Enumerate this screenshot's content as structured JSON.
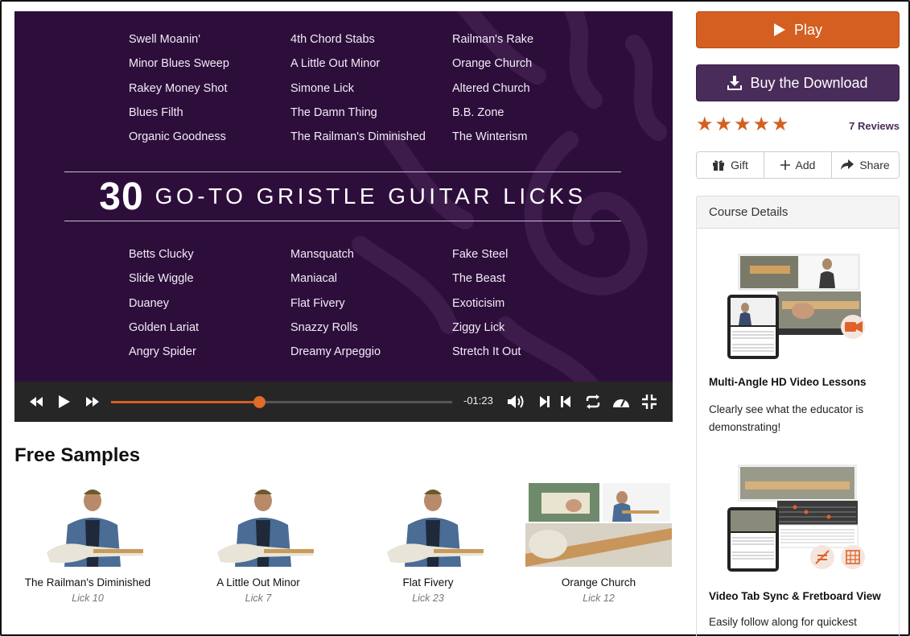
{
  "video": {
    "title_number": "30",
    "title_text": "GO-TO GRISTLE GUITAR LICKS",
    "top_columns": [
      [
        "Swell Moanin'",
        "Minor Blues Sweep",
        "Rakey Money Shot",
        "Blues Filth",
        "Organic Goodness"
      ],
      [
        "4th Chord Stabs",
        "A Little Out Minor",
        "Simone Lick",
        "The Damn Thing",
        "The Railman's Diminished"
      ],
      [
        "Railman's Rake",
        "Orange Church",
        "Altered Church",
        "B.B. Zone",
        "The Winterism"
      ]
    ],
    "bottom_columns": [
      [
        "Betts Clucky",
        "Slide Wiggle",
        "Duaney",
        "Golden Lariat",
        "Angry Spider"
      ],
      [
        "Mansquatch",
        "Maniacal",
        "Flat Fivery",
        "Snazzy Rolls",
        "Dreamy Arpeggio"
      ],
      [
        "Fake Steel",
        "The Beast",
        "Exoticisim",
        "Ziggy Lick",
        "Stretch It Out"
      ]
    ],
    "player": {
      "time_remaining": "-01:23",
      "progress_fraction": 0.435,
      "icons": [
        "rewind-icon",
        "play-icon",
        "fast-forward-icon",
        "volume-icon",
        "next-icon",
        "previous-icon",
        "loop-icon",
        "speed-icon",
        "fullscreen-exit-icon"
      ]
    }
  },
  "samples": {
    "heading": "Free Samples",
    "items": [
      {
        "name": "The Railman's Diminished",
        "sub": "Lick 10"
      },
      {
        "name": "A Little Out Minor",
        "sub": "Lick 7"
      },
      {
        "name": "Flat Fivery",
        "sub": "Lick 23"
      },
      {
        "name": "Orange Church",
        "sub": "Lick 12"
      }
    ]
  },
  "sidebar": {
    "play_label": "Play",
    "buy_label": "Buy the Download",
    "rating_stars": 5,
    "reviews_label": "7 Reviews",
    "actions": {
      "gift": "Gift",
      "add": "Add",
      "share": "Share"
    },
    "details_heading": "Course Details",
    "features": [
      {
        "title": "Multi-Angle HD Video Lessons",
        "desc": "Clearly see what the educator is demonstrating!"
      },
      {
        "title": "Video Tab Sync & Fretboard View",
        "desc": "Easily follow along for quickest"
      }
    ]
  },
  "colors": {
    "accent_orange": "#d45f21",
    "brand_purple": "#4a2c5a",
    "video_background": "#2d0e3b"
  }
}
